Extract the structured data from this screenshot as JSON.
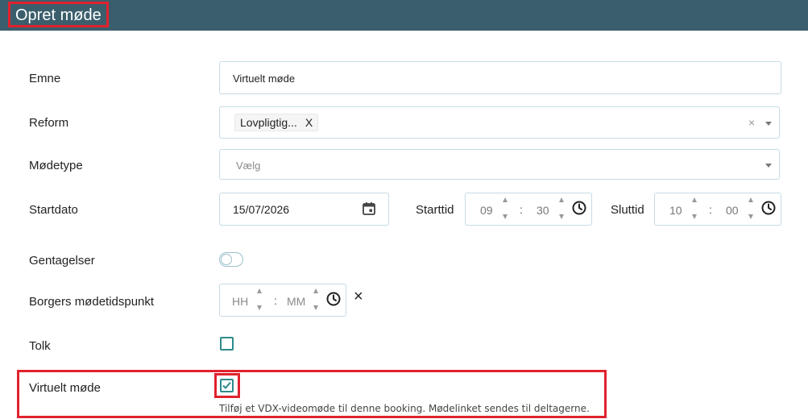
{
  "header": {
    "title": "Opret møde"
  },
  "form": {
    "emne": {
      "label": "Emne",
      "value": "Virtuelt møde"
    },
    "reform": {
      "label": "Reform",
      "tag": "Lovpligtig...",
      "tag_remove": "X",
      "clear": "×"
    },
    "modetype": {
      "label": "Mødetype",
      "placeholder": "Vælg"
    },
    "startdato": {
      "label": "Startdato",
      "value": "15/07/2026"
    },
    "starttid": {
      "label": "Starttid",
      "hour": "09",
      "minute": "30",
      "sep": ":"
    },
    "sluttid": {
      "label": "Sluttid",
      "hour": "10",
      "minute": "00",
      "sep": ":"
    },
    "gentagelser": {
      "label": "Gentagelser",
      "checked": false
    },
    "borgers": {
      "label": "Borgers mødetidspunkt",
      "hour_placeholder": "HH",
      "minute_placeholder": "MM",
      "sep": ":",
      "clear": "×"
    },
    "tolk": {
      "label": "Tolk",
      "checked": false
    },
    "virtuelt": {
      "label": "Virtuelt møde",
      "checked": true,
      "help": "Tilføj et VDX-videomøde til denne booking. Mødelinket sendes til deltagerne."
    }
  },
  "colors": {
    "header_bg": "#3b5e6c",
    "highlight": "#e0222e",
    "accent": "#2e8b8b",
    "border": "#c6dbe6"
  }
}
